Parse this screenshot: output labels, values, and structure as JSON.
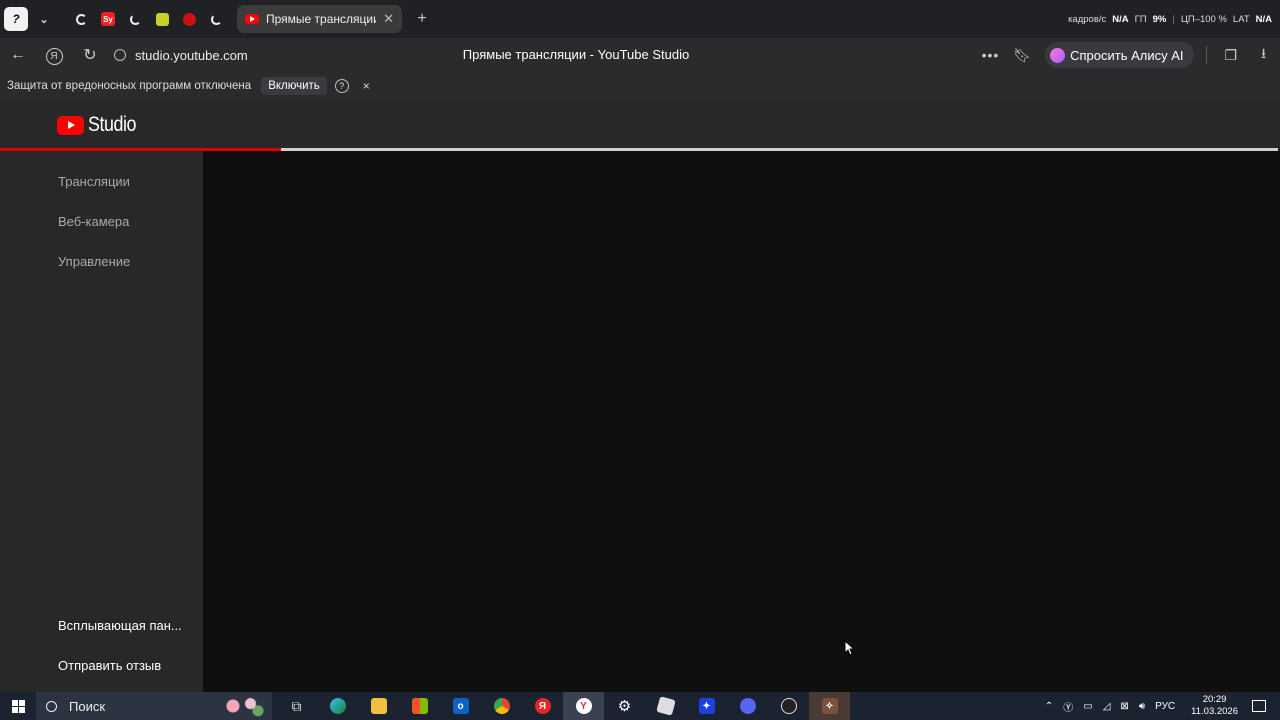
{
  "browser": {
    "app_button": "?",
    "tab_sy_label": "Sy",
    "active_tab_title": "Прямые трансляции -",
    "new_tab": "+",
    "sysinfo": {
      "fps_label": "кадров/с",
      "fps_value": "N/A",
      "gpu_label": "ГП",
      "gpu_value": "9%",
      "cpu_label": "ЦП–100 %",
      "lang": "LAT",
      "na": "N/A"
    },
    "url": "studio.youtube.com",
    "page_title": "Прямые трансляции - YouTube Studio",
    "alice_button": "Спросить Алису AI"
  },
  "notification": {
    "text": "Защита от вредоносных программ отключена",
    "enable_button": "Включить",
    "help": "?",
    "close": "×"
  },
  "studio": {
    "logo_text": "Studio",
    "loading_progress": 0.22,
    "sidebar": {
      "items": [
        {
          "label": "Трансляции"
        },
        {
          "label": "Веб-камера"
        },
        {
          "label": "Управление"
        }
      ],
      "bottom": [
        {
          "label": "Всплывающая пан..."
        },
        {
          "label": "Отправить отзыв"
        }
      ]
    }
  },
  "taskbar": {
    "search_placeholder": "Поиск",
    "tray": {
      "language": "РУС",
      "time": "20:29",
      "date": "11.03.2026"
    }
  },
  "colors": {
    "youtube_red": "#ff0000",
    "progress_red": "#e00000",
    "sidebar_bg": "#282828",
    "main_bg": "#0f0f0f"
  }
}
